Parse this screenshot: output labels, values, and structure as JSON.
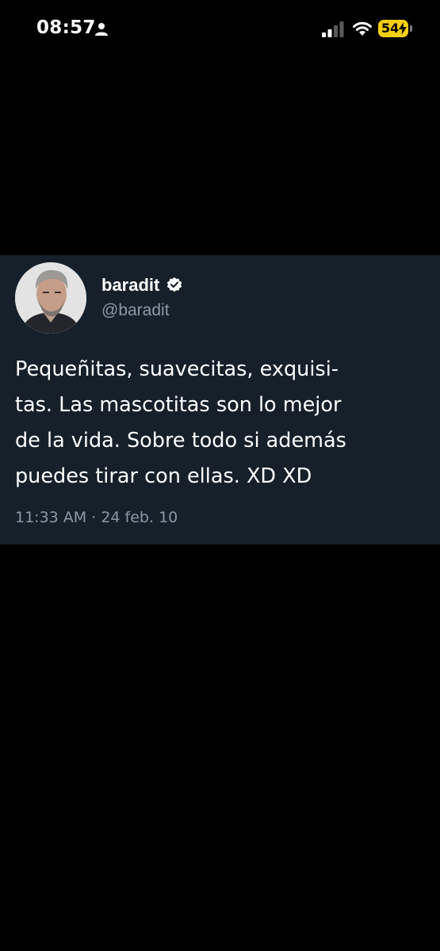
{
  "status_bar": {
    "time": "08:57",
    "battery_level": "54",
    "battery_color": "#f4cf0f",
    "icons": [
      "person-icon",
      "signal-icon",
      "wifi-icon",
      "charging-bolt-icon"
    ]
  },
  "tweet": {
    "display_name": "baradit",
    "handle": "@baradit",
    "verified": true,
    "text_lines": [
      "Pequeñitas, suavecitas, exquisi-",
      "tas. Las mascotitas son lo mejor",
      "de la vida. Sobre todo si además",
      "puedes tirar con ellas. XD XD"
    ],
    "time": "11:33 AM",
    "separator": "·",
    "date": "24 feb. 10",
    "card_background": "#15202b",
    "secondary_text_color": "#8b98a5",
    "verified_color": "#ffffff"
  }
}
